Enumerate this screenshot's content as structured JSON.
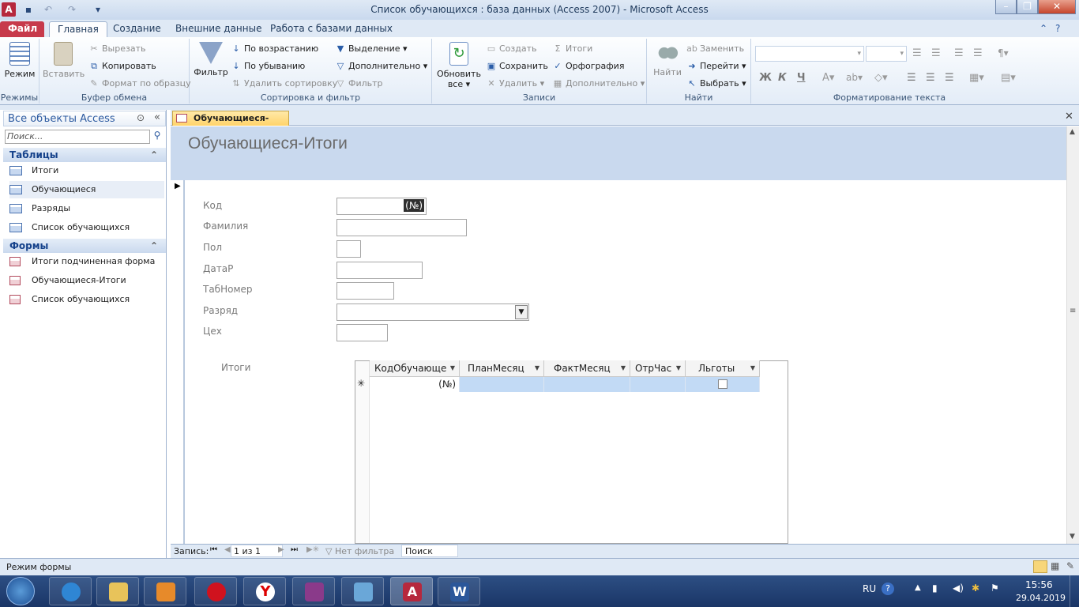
{
  "window": {
    "title": "Список обучающихся : база данных (Access 2007)  -  Microsoft Access"
  },
  "tabs": [
    "Файл",
    "Главная",
    "Создание",
    "Внешние данные",
    "Работа с базами данных"
  ],
  "ribbon": {
    "modes": {
      "view": "Режим",
      "label": "Режимы"
    },
    "clipboard": {
      "paste": "Вставить",
      "cut": "Вырезать",
      "copy": "Копировать",
      "format_painter": "Формат по образцу",
      "label": "Буфер обмена"
    },
    "sort_filter": {
      "filter": "Фильтр",
      "ascending": "По возрастанию",
      "descending": "По убыванию",
      "remove_sort": "Удалить сортировку",
      "selection": "Выделение",
      "advanced": "Дополнительно",
      "toggle_filter": "Фильтр",
      "label": "Сортировка и фильтр"
    },
    "records": {
      "refresh": "Обновить",
      "refresh2": "все",
      "new": "Создать",
      "save": "Сохранить",
      "delete": "Удалить",
      "totals": "Итоги",
      "spelling": "Орфография",
      "more": "Дополнительно",
      "label": "Записи"
    },
    "find": {
      "find": "Найти",
      "replace": "Заменить",
      "goto": "Перейти",
      "select": "Выбрать",
      "label": "Найти"
    },
    "text_format": {
      "bold": "Ж",
      "italic": "К",
      "underline": "Ч",
      "label": "Форматирование текста"
    }
  },
  "nav": {
    "header": "Все объекты Access",
    "search_placeholder": "Поиск...",
    "tables_header": "Таблицы",
    "tables": [
      "Итоги",
      "Обучающиеся",
      "Разряды",
      "Список обучающихся"
    ],
    "forms_header": "Формы",
    "forms": [
      "Итоги подчиненная форма",
      "Обучающиеся-Итоги",
      "Список обучающихся"
    ]
  },
  "document": {
    "tab": "Обучающиеся-Итоги",
    "form_title": "Обучающиеся-Итоги",
    "fields": {
      "kod": "Код",
      "familiya": "Фамилия",
      "pol": "Пол",
      "datar": "ДатаР",
      "tabnomer": "ТабНомер",
      "razryad": "Разряд",
      "tseh": "Цех"
    },
    "kod_value": "(№)",
    "subform_label": "Итоги",
    "subform_columns": [
      "КодОбучающе",
      "ПланМесяц",
      "ФактМесяц",
      "ОтрЧас",
      "Льготы"
    ],
    "subform_new_row": "(№)",
    "new_row_marker": "✳"
  },
  "record_nav": {
    "label": "Запись:",
    "position": "1 из 1",
    "filter": "Нет фильтра",
    "search": "Поиск"
  },
  "status": {
    "text": "Режим формы"
  },
  "taskbar": {
    "lang": "RU",
    "time": "15:56",
    "date": "29.04.2019"
  },
  "colors": {
    "file_tab": "#c73a4b",
    "header": "#c9d9ee",
    "active_tab": "#ffd36a"
  }
}
